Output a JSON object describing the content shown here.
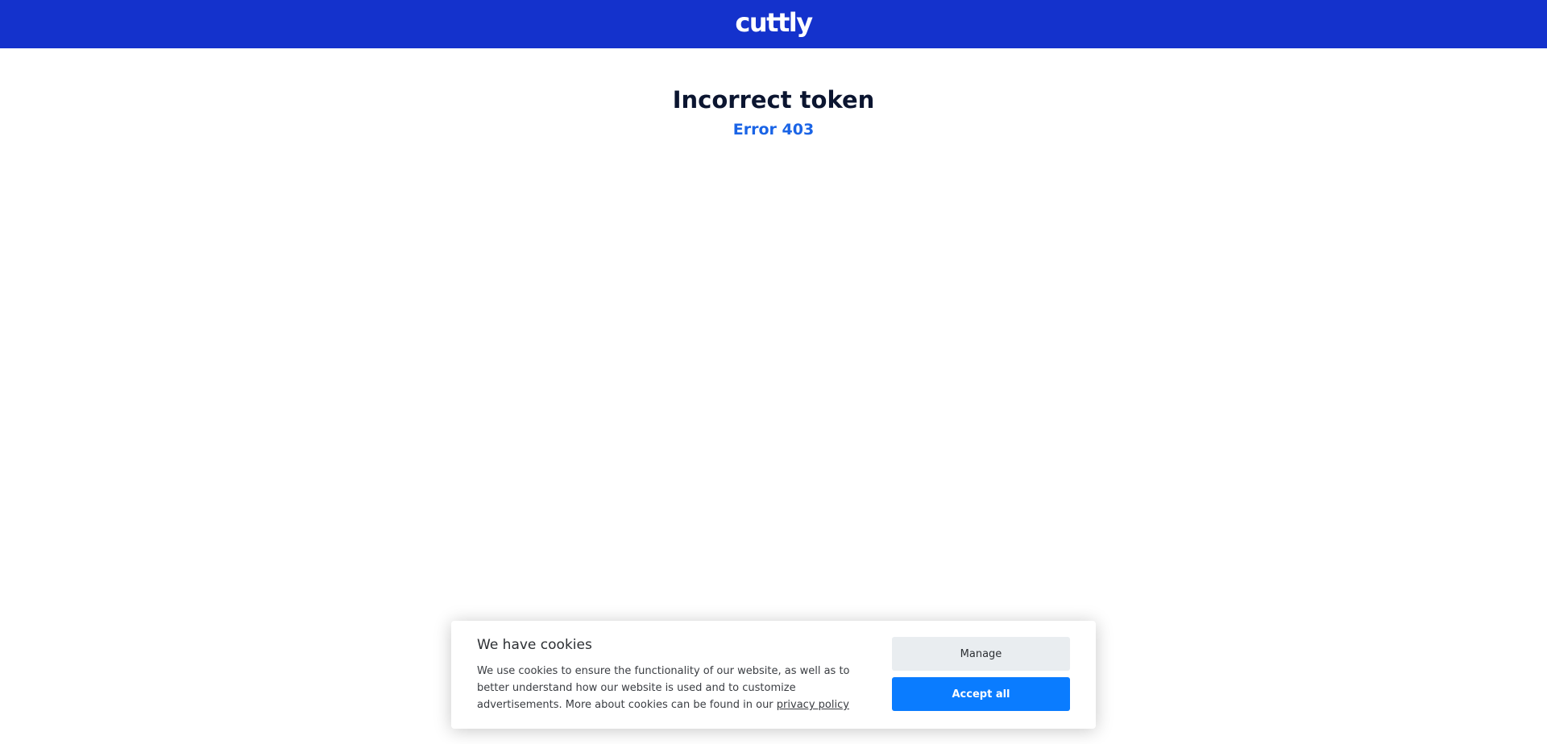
{
  "header": {
    "logo_text": "cuttly",
    "background": "#1432cc"
  },
  "error": {
    "title": "Incorrect token",
    "code_text": "Error 403",
    "code_color": "#1a64e6"
  },
  "cookie_banner": {
    "title": "We have cookies",
    "description": "We use cookies to ensure the functionality of our website, as well as to better understand how our website is used and to customize advertisements. More about cookies can be found in our ",
    "link_text": "privacy policy",
    "manage_label": "Manage",
    "accept_label": "Accept all",
    "accept_color": "#0a7cff"
  }
}
